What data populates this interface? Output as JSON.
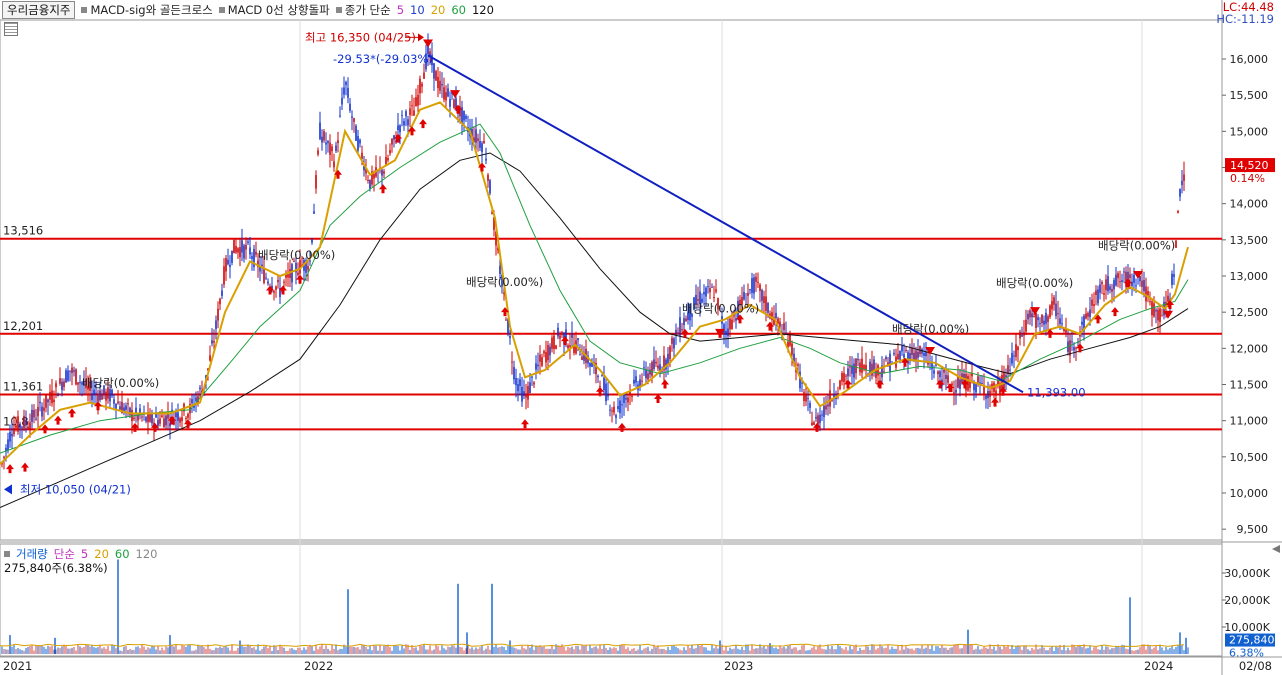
{
  "header": {
    "stock_name": "우리금융지주",
    "indicators": [
      {
        "label": "MACD-sig와 골든크로스",
        "color": "#b0306a"
      },
      {
        "label": "MACD 0선 상향돌파",
        "color": "#b0306a"
      },
      {
        "label": "종가 단순",
        "color": "#c030c0"
      }
    ],
    "ma_periods": [
      {
        "label": "5",
        "color": "#c030c0"
      },
      {
        "label": "10",
        "color": "#2040d0"
      },
      {
        "label": "20",
        "color": "#d8a000"
      },
      {
        "label": "60",
        "color": "#20a040"
      },
      {
        "label": "120",
        "color": "#111111"
      }
    ],
    "lc": "LC:44.48",
    "hc": "HC:-11.19"
  },
  "volume_header": {
    "title": "거래량",
    "ma_label": "단순",
    "ma_periods": [
      {
        "label": "5",
        "color": "#c030c0"
      },
      {
        "label": "20",
        "color": "#d8a000"
      },
      {
        "label": "60",
        "color": "#20a040"
      },
      {
        "label": "120",
        "color": "#888888"
      }
    ],
    "info": "275,840주(6.38%)"
  },
  "x_labels": [
    "2021",
    "2022",
    "2023",
    "2024"
  ],
  "corner_date": "02/08",
  "colors": {
    "up": "#d00000",
    "down": "#1030d0",
    "ma5": "#c030c0",
    "ma20": "#d8a000",
    "ma60": "#20a040",
    "ma120": "#111111",
    "hline": "#e00000",
    "trend": "#1020c0",
    "vol": "#1060d0",
    "vol_ma5": "#c030c0",
    "vol_ma20": "#d8a000",
    "vol_ma60": "#20a040"
  },
  "chart_data": [
    {
      "type": "candlestick",
      "title": "우리금융지주",
      "x_axis": [
        "2021",
        "2022",
        "2023",
        "2024"
      ],
      "y_ticks": [
        "16,000",
        "15,500",
        "15,000",
        "14,500",
        "14,000",
        "13,500",
        "13,000",
        "12,500",
        "12,000",
        "11,500",
        "11,000",
        "10,500",
        "10,000",
        "9,500"
      ],
      "ylim": [
        9300,
        16500
      ],
      "horizontal_lines": [
        {
          "label": "13,516",
          "value": 13516
        },
        {
          "label": "12,201",
          "value": 12201
        },
        {
          "label": "11,361",
          "value": 11361,
          "light": true
        },
        {
          "label": "",
          "value": 11361
        },
        {
          "label": "10,8",
          "value": 10880
        }
      ],
      "price_path": [
        [
          0,
          10300
        ],
        [
          12,
          10900
        ],
        [
          30,
          11000
        ],
        [
          50,
          11300
        ],
        [
          70,
          11700
        ],
        [
          90,
          11400
        ],
        [
          110,
          11350
        ],
        [
          130,
          11100
        ],
        [
          150,
          11000
        ],
        [
          170,
          11050
        ],
        [
          190,
          11150
        ],
        [
          205,
          11500
        ],
        [
          215,
          12200
        ],
        [
          225,
          13100
        ],
        [
          235,
          13400
        ],
        [
          250,
          13350
        ],
        [
          265,
          13000
        ],
        [
          280,
          12800
        ],
        [
          295,
          13100
        ],
        [
          310,
          13200
        ],
        [
          320,
          15000
        ],
        [
          335,
          14600
        ],
        [
          345,
          15700
        ],
        [
          355,
          15000
        ],
        [
          370,
          14300
        ],
        [
          385,
          14500
        ],
        [
          400,
          15100
        ],
        [
          415,
          15300
        ],
        [
          428,
          16100
        ],
        [
          440,
          15600
        ],
        [
          455,
          15400
        ],
        [
          470,
          15000
        ],
        [
          485,
          14800
        ],
        [
          495,
          13600
        ],
        [
          505,
          12600
        ],
        [
          515,
          11600
        ],
        [
          525,
          11300
        ],
        [
          540,
          11800
        ],
        [
          560,
          12200
        ],
        [
          580,
          12000
        ],
        [
          600,
          11600
        ],
        [
          615,
          11100
        ],
        [
          630,
          11400
        ],
        [
          650,
          11700
        ],
        [
          665,
          11800
        ],
        [
          680,
          12300
        ],
        [
          700,
          12700
        ],
        [
          715,
          12800
        ],
        [
          725,
          12200
        ],
        [
          740,
          12600
        ],
        [
          755,
          12900
        ],
        [
          770,
          12500
        ],
        [
          790,
          12100
        ],
        [
          805,
          11300
        ],
        [
          815,
          10950
        ],
        [
          830,
          11300
        ],
        [
          845,
          11600
        ],
        [
          860,
          11800
        ],
        [
          880,
          11700
        ],
        [
          900,
          11900
        ],
        [
          920,
          11950
        ],
        [
          935,
          11700
        ],
        [
          950,
          11500
        ],
        [
          970,
          11550
        ],
        [
          990,
          11400
        ],
        [
          1000,
          11450
        ],
        [
          1015,
          11900
        ],
        [
          1030,
          12500
        ],
        [
          1040,
          12300
        ],
        [
          1055,
          12600
        ],
        [
          1070,
          12000
        ],
        [
          1080,
          12200
        ],
        [
          1095,
          12700
        ],
        [
          1110,
          12900
        ],
        [
          1125,
          12950
        ],
        [
          1140,
          13000
        ],
        [
          1150,
          12600
        ],
        [
          1160,
          12450
        ],
        [
          1168,
          12600
        ],
        [
          1175,
          13200
        ],
        [
          1180,
          14200
        ],
        [
          1185,
          14500
        ]
      ],
      "ma20_path": [
        [
          0,
          10400
        ],
        [
          30,
          10800
        ],
        [
          60,
          11150
        ],
        [
          90,
          11250
        ],
        [
          130,
          11100
        ],
        [
          170,
          11100
        ],
        [
          200,
          11250
        ],
        [
          225,
          12500
        ],
        [
          250,
          13200
        ],
        [
          280,
          13000
        ],
        [
          300,
          13100
        ],
        [
          320,
          13400
        ],
        [
          345,
          15000
        ],
        [
          370,
          14400
        ],
        [
          395,
          14600
        ],
        [
          420,
          15300
        ],
        [
          440,
          15400
        ],
        [
          470,
          15000
        ],
        [
          495,
          13800
        ],
        [
          510,
          12300
        ],
        [
          525,
          11600
        ],
        [
          545,
          11700
        ],
        [
          575,
          12050
        ],
        [
          600,
          11700
        ],
        [
          620,
          11350
        ],
        [
          645,
          11500
        ],
        [
          670,
          11800
        ],
        [
          700,
          12300
        ],
        [
          725,
          12400
        ],
        [
          750,
          12600
        ],
        [
          775,
          12400
        ],
        [
          800,
          11600
        ],
        [
          820,
          11200
        ],
        [
          845,
          11400
        ],
        [
          875,
          11700
        ],
        [
          905,
          11850
        ],
        [
          935,
          11800
        ],
        [
          960,
          11600
        ],
        [
          990,
          11450
        ],
        [
          1010,
          11550
        ],
        [
          1035,
          12200
        ],
        [
          1060,
          12300
        ],
        [
          1080,
          12200
        ],
        [
          1105,
          12600
        ],
        [
          1130,
          12850
        ],
        [
          1150,
          12700
        ],
        [
          1165,
          12550
        ],
        [
          1175,
          12750
        ],
        [
          1188,
          13400
        ]
      ],
      "ma60_path": [
        [
          0,
          10550
        ],
        [
          50,
          10800
        ],
        [
          100,
          11000
        ],
        [
          150,
          11100
        ],
        [
          190,
          11150
        ],
        [
          230,
          11800
        ],
        [
          260,
          12300
        ],
        [
          300,
          12800
        ],
        [
          330,
          13700
        ],
        [
          360,
          14100
        ],
        [
          400,
          14500
        ],
        [
          440,
          14850
        ],
        [
          480,
          15100
        ],
        [
          500,
          14700
        ],
        [
          530,
          13700
        ],
        [
          560,
          12800
        ],
        [
          590,
          12100
        ],
        [
          620,
          11800
        ],
        [
          660,
          11650
        ],
        [
          700,
          11800
        ],
        [
          740,
          12000
        ],
        [
          780,
          12150
        ],
        [
          810,
          12000
        ],
        [
          840,
          11800
        ],
        [
          880,
          11650
        ],
        [
          920,
          11750
        ],
        [
          960,
          11700
        ],
        [
          1000,
          11550
        ],
        [
          1040,
          11850
        ],
        [
          1080,
          12100
        ],
        [
          1120,
          12400
        ],
        [
          1150,
          12550
        ],
        [
          1175,
          12650
        ],
        [
          1188,
          12950
        ]
      ],
      "ma120_path": [
        [
          0,
          9800
        ],
        [
          50,
          10100
        ],
        [
          100,
          10400
        ],
        [
          150,
          10700
        ],
        [
          200,
          11000
        ],
        [
          250,
          11400
        ],
        [
          300,
          11850
        ],
        [
          340,
          12600
        ],
        [
          380,
          13500
        ],
        [
          420,
          14200
        ],
        [
          460,
          14600
        ],
        [
          490,
          14700
        ],
        [
          520,
          14450
        ],
        [
          560,
          13800
        ],
        [
          600,
          13100
        ],
        [
          640,
          12500
        ],
        [
          670,
          12200
        ],
        [
          700,
          12100
        ],
        [
          740,
          12150
        ],
        [
          780,
          12200
        ],
        [
          820,
          12150
        ],
        [
          860,
          12100
        ],
        [
          900,
          12050
        ],
        [
          940,
          11900
        ],
        [
          980,
          11750
        ],
        [
          1010,
          11650
        ],
        [
          1050,
          11850
        ],
        [
          1090,
          12000
        ],
        [
          1130,
          12150
        ],
        [
          1160,
          12300
        ],
        [
          1188,
          12550
        ]
      ],
      "up_arrows": [
        [
          10,
          10330
        ],
        [
          25,
          10350
        ],
        [
          45,
          10880
        ],
        [
          58,
          11000
        ],
        [
          72,
          11100
        ],
        [
          98,
          11200
        ],
        [
          135,
          10900
        ],
        [
          155,
          10900
        ],
        [
          172,
          11000
        ],
        [
          188,
          10950
        ],
        [
          270,
          12800
        ],
        [
          283,
          12800
        ],
        [
          300,
          12950
        ],
        [
          338,
          14400
        ],
        [
          383,
          14200
        ],
        [
          398,
          14900
        ],
        [
          412,
          15000
        ],
        [
          423,
          15100
        ],
        [
          458,
          15300
        ],
        [
          482,
          14500
        ],
        [
          505,
          12500
        ],
        [
          525,
          10950
        ],
        [
          565,
          12100
        ],
        [
          600,
          11400
        ],
        [
          622,
          10900
        ],
        [
          658,
          11300
        ],
        [
          665,
          11500
        ],
        [
          685,
          12200
        ],
        [
          720,
          12200
        ],
        [
          740,
          12400
        ],
        [
          770,
          12300
        ],
        [
          817,
          10900
        ],
        [
          848,
          11500
        ],
        [
          880,
          11500
        ],
        [
          905,
          11800
        ],
        [
          940,
          11500
        ],
        [
          950,
          11450
        ],
        [
          965,
          11500
        ],
        [
          995,
          11250
        ],
        [
          1003,
          11400
        ],
        [
          1050,
          12200
        ],
        [
          1080,
          12000
        ],
        [
          1098,
          12400
        ],
        [
          1115,
          12500
        ],
        [
          1128,
          12900
        ],
        [
          1170,
          12600
        ]
      ],
      "down_arrows": [
        [
          428,
          16200
        ],
        [
          455,
          15500
        ],
        [
          720,
          12200
        ],
        [
          930,
          11950
        ],
        [
          1035,
          12500
        ],
        [
          1138,
          13000
        ],
        [
          1168,
          12450
        ]
      ],
      "annotations": [
        {
          "text": "최고 16,350 (04/25)",
          "value": 16300,
          "color": "#d00000"
        },
        {
          "text": "-29.53*(-29.03%)",
          "value": 16000,
          "color": "#1030d0"
        },
        {
          "text": "최저 10,050 (04/21)",
          "value": 10050,
          "color": "#1030d0"
        },
        {
          "text": "배당락(0.00%)",
          "value": 11520
        },
        {
          "text": "배당락(0.00%)",
          "value": 13290
        },
        {
          "text": "배당락(0.00%)",
          "value": 12920
        },
        {
          "text": "배당락(0.00%)",
          "value": 12550
        },
        {
          "text": "배당락(0.00%)",
          "value": 12270
        },
        {
          "text": "배당락(0.00%)",
          "value": 12900
        },
        {
          "text": "배당락(0.00%)",
          "value": 13420
        },
        {
          "text": "11,393.00",
          "value": 11390,
          "color": "#1030d0"
        }
      ],
      "trendline": {
        "from": [
          428,
          16050
        ],
        "to": [
          1023,
          11393
        ]
      },
      "last_price": {
        "label": "14,520",
        "change": "0.14%",
        "value": 14520
      }
    },
    {
      "type": "bar",
      "title": "거래량",
      "y_ticks": [
        "30,000K",
        "20,000K",
        "10,000K"
      ],
      "ylim": [
        0,
        36000
      ],
      "spikes": [
        [
          10,
          7000
        ],
        [
          55,
          6000
        ],
        [
          118,
          35000
        ],
        [
          170,
          7000
        ],
        [
          240,
          5000
        ],
        [
          348,
          24000
        ],
        [
          458,
          26000
        ],
        [
          467,
          8000
        ],
        [
          492,
          26000
        ],
        [
          510,
          5000
        ],
        [
          720,
          5000
        ],
        [
          770,
          4000
        ],
        [
          968,
          9000
        ],
        [
          1130,
          21000
        ],
        [
          1180,
          8000
        ],
        [
          1186,
          6000
        ]
      ],
      "baseline": 2800,
      "last_volume": {
        "label": "275,840",
        "pct": "6.38%",
        "value": 2758
      }
    }
  ]
}
